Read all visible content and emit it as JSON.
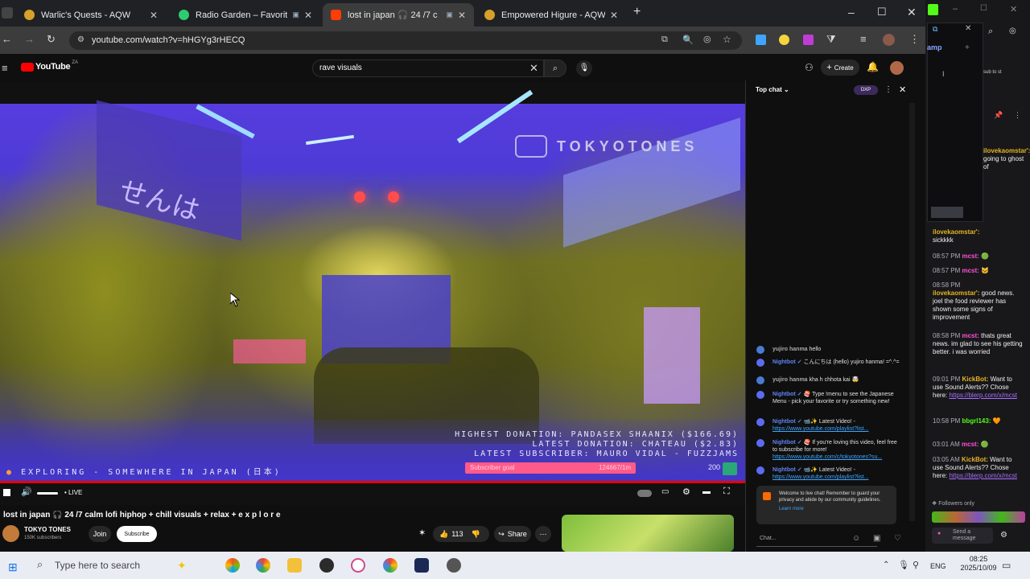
{
  "browser": {
    "tabs": [
      {
        "title": "Warlic's Quests - AQW",
        "color": "#d6a02a",
        "active": false
      },
      {
        "title": "Radio Garden – Favorites",
        "color": "#2ecc71",
        "active": false
      },
      {
        "title": "lost in japan 🎧 24 /7 c",
        "color": "#ff3d00",
        "active": true
      },
      {
        "title": "Empowered Higure - AQW",
        "color": "#d6a02a",
        "active": false
      }
    ],
    "url": "youtube.com/watch?v=hHGYg3rHECQ",
    "new_tab": "+",
    "win_min": "–",
    "win_max": "☐",
    "win_close": "✕"
  },
  "youtube": {
    "logo": "YouTube",
    "logo_region": "ZA",
    "search_value": "rave visuals",
    "create_label": "Create"
  },
  "video": {
    "overlay_brand": "TOKYOTONES",
    "highest_donation": "HIGHEST DONATION: PANDASEX SHAANIX  ($166.69)",
    "latest_donation": "LATEST DONATION: CHATEAU ($2.83)",
    "latest_subscriber": "LATEST SUBSCRIBER: MAURO VIDAL - FUZZJAMS",
    "exploring": "EXPLORING - SOMEWHERE IN JAPAN (日本)",
    "subscriber_goal": "Subscriber goal",
    "goal_count": "124667/1m",
    "corner_num": "200",
    "live_label": "• LIVE"
  },
  "meta": {
    "title": "lost in japan 🎧 24 /7 calm lofi hiphop + chill visuals + relax + e x p l o r e",
    "channel": "TOKYO TONES",
    "subscribers": "150K subscribers",
    "join": "Join",
    "subscribe": "Subscribe",
    "likes": "113",
    "share": "Share"
  },
  "chat": {
    "header": "Top chat",
    "badge": "DXP",
    "placeholder": "Chat...",
    "welcome": "Welcome to live chat! Remember to guard your privacy and abide by our community guidelines.",
    "learn_more": "Learn more",
    "messages": [
      {
        "author": "yujiro hanma",
        "text": "hello"
      },
      {
        "author": "Nightbot ✓",
        "text": "こんにちは (hello) yujiro hanma! =^.^="
      },
      {
        "author": "yujiro hanma",
        "text": "kha h chhota kai 🤯"
      },
      {
        "author": "Nightbot ✓",
        "text": "🍣 Type !menu to see the Japanese Menu - pick your favorite or try something new!"
      },
      {
        "author": "Nightbot ✓",
        "text": "📹✨ Latest Video! - ",
        "link": "https://www.youtube.com/playlist?list..."
      },
      {
        "author": "Nightbot ✓",
        "text": "🍣 If you're loving this video, feel free to subscribe for more! ",
        "link": "https://www.youtube.com/c/tokyotones?su..."
      },
      {
        "author": "Nightbot ✓",
        "text": "📹✨ Latest Video! - ",
        "link": "https://www.youtube.com/playlist?list..."
      }
    ]
  },
  "side_chat": {
    "header_fragment": "amp",
    "sub_text": "sub to st",
    "messages": [
      {
        "time": "",
        "user": "ilovekaomstar':",
        "text": "going to ghost of",
        "color": "#e6b422"
      },
      {
        "time": "",
        "user": "ilovekaomstar':",
        "text": "sickkkk",
        "color": "#e6b422"
      },
      {
        "time": "08:57 PM",
        "user": "mcst:",
        "text": "🟢",
        "color": "#ff4fd8"
      },
      {
        "time": "08:57 PM",
        "user": "mcst:",
        "text": "🐱",
        "color": "#ff4fd8"
      },
      {
        "time": "08:58 PM",
        "user": "ilovekaomstar':",
        "text": "good news. joel the food reviewer has shown some signs of improvement",
        "color": "#e6b422"
      },
      {
        "time": "08:58 PM",
        "user": "mcst:",
        "text": "thats great news. im glad to see his getting better. i was worried",
        "color": "#ff4fd8"
      },
      {
        "time": "09:01 PM",
        "user": "KickBot:",
        "text": "Want to use Sound Alerts?? Chose here: ",
        "link": "https://blerp.com/x/mcst",
        "color": "#e6b422"
      },
      {
        "time": "10:58 PM",
        "user": "bbgrl143:",
        "text": "🧡",
        "color": "#53fc18"
      },
      {
        "time": "03:01 AM",
        "user": "mcst:",
        "text": "🟢",
        "color": "#ff4fd8"
      },
      {
        "time": "03:05 AM",
        "user": "KickBot:",
        "text": "Want to use Sound Alerts?? Chose here: ",
        "link": "https://blerp.com/x/mcst",
        "color": "#e6b422"
      }
    ],
    "followers_only": "Followers only",
    "send": "Send a message"
  },
  "taskbar": {
    "search_placeholder": "Type here to search",
    "lang": "ENG",
    "time": "08:25",
    "date": "2025/10/09"
  }
}
